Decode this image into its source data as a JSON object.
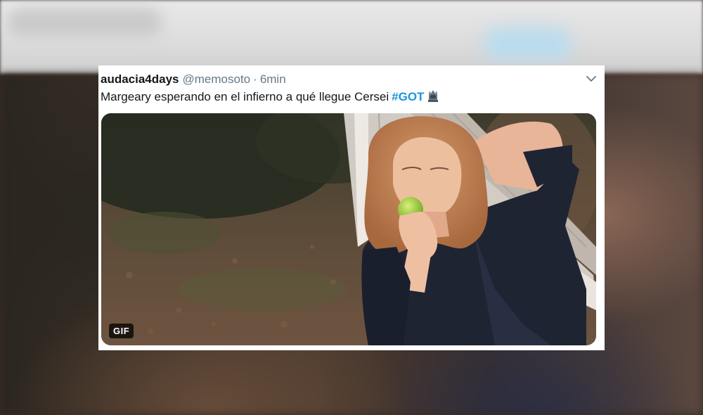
{
  "tweet": {
    "display_name": "audacia4days",
    "handle": "@memosoto",
    "separator": "·",
    "timestamp": "6min",
    "text": "Margeary esperando en el infierno a qué llegue Cersei",
    "hashtag": "#GOT",
    "hashtag_color": "#1b95e0",
    "emoji": "throne-emoji-icon",
    "menu_icon": "chevron-down-icon"
  },
  "media": {
    "badge": "GIF",
    "subject": "woman-eating-green-apple-in-hammock"
  }
}
